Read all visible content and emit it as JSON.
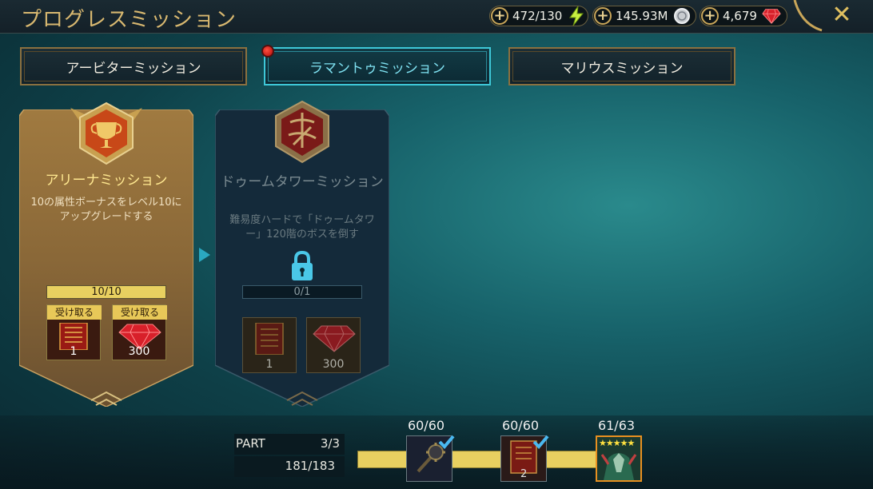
{
  "header": {
    "title": "プログレスミッション",
    "resources": [
      {
        "name": "energy",
        "value": "472/130",
        "icon": "lightning-icon"
      },
      {
        "name": "silver",
        "value": "145.93M",
        "icon": "silver-coin-icon"
      },
      {
        "name": "gems",
        "value": "4,679",
        "icon": "ruby-icon"
      }
    ],
    "close_icon": "✕"
  },
  "tabs": [
    {
      "label": "アービターミッション",
      "active": false
    },
    {
      "label": "ラマントゥミッション",
      "active": true
    },
    {
      "label": "マリウスミッション",
      "active": false
    }
  ],
  "missions": [
    {
      "name": "アリーナミッション",
      "desc": "10の属性ボーナスをレベル10にアップグレードする",
      "progress": "10/10",
      "progress_fraction": 1.0,
      "state": "complete",
      "claim_label": "受け取る",
      "rewards": [
        {
          "icon": "tome-icon",
          "count": "1"
        },
        {
          "icon": "ruby-icon",
          "count": "300"
        }
      ]
    },
    {
      "name": "ドゥームタワーミッション",
      "desc": "難易度ハードで「ドゥームタワー」120階のボスを倒す",
      "progress": "0/1",
      "progress_fraction": 0.0,
      "state": "locked",
      "rewards": [
        {
          "icon": "tome-icon",
          "count": "1"
        },
        {
          "icon": "ruby-icon",
          "count": "300"
        }
      ]
    }
  ],
  "part_progress": {
    "part_label": "PART",
    "part_value": "3/3",
    "total": "181/183",
    "milestones": [
      {
        "value": "60/60",
        "icon": "mace-icon",
        "claimed": true,
        "count": ""
      },
      {
        "value": "60/60",
        "icon": "tome-icon",
        "claimed": true,
        "count": "2"
      },
      {
        "value": "61/63",
        "icon": "champion-portrait-icon",
        "claimed": false,
        "stars": 5
      }
    ]
  },
  "colors": {
    "gold": "#d8b870",
    "active_tab": "#3ec8d8",
    "bar_fill": "#e8d060"
  }
}
